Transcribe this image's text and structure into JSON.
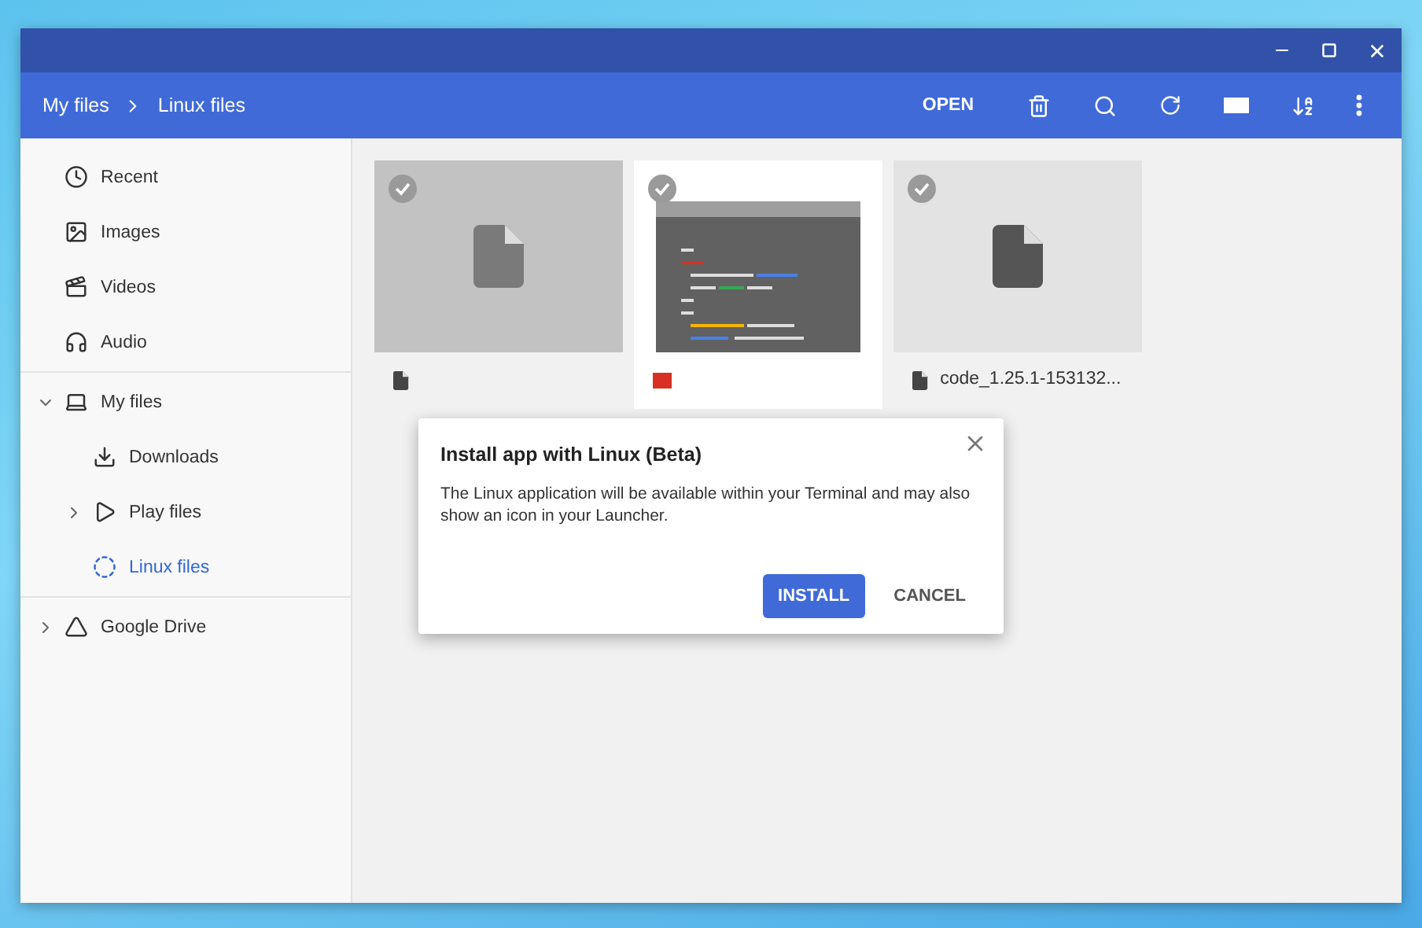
{
  "breadcrumb": [
    "My files",
    "Linux files"
  ],
  "toolbar": {
    "open_label": "OPEN"
  },
  "sidebar": {
    "items": [
      {
        "label": "Recent",
        "kind": "recent",
        "selected": false
      },
      {
        "label": "Images",
        "kind": "images",
        "selected": false
      },
      {
        "label": "Videos",
        "kind": "videos",
        "selected": false
      },
      {
        "label": "Audio",
        "kind": "audio",
        "selected": false
      },
      {
        "label": "My files",
        "kind": "computer",
        "selected": false,
        "expanded": true,
        "children": [
          {
            "label": "Downloads",
            "kind": "download",
            "selected": false
          },
          {
            "label": "Play files",
            "kind": "play",
            "selected": false,
            "expanded": false
          },
          {
            "label": "Linux files",
            "kind": "linux",
            "selected": true
          }
        ]
      },
      {
        "label": "Google Drive",
        "kind": "drive",
        "selected": false,
        "expanded": false
      }
    ]
  },
  "files": [
    {
      "kind": "generic-light",
      "hovered": false
    },
    {
      "kind": "screenshot",
      "hovered": true
    },
    {
      "kind": "generic-dark",
      "hovered": false,
      "name": "code_1.25.1-153132..."
    }
  ],
  "dialog": {
    "title": "Install app with Linux (Beta)",
    "message": "The Linux application will be available within your Terminal and may also show an icon in your Launcher.",
    "buttons": [
      {
        "label": "INSTALL",
        "kind": "primary"
      },
      {
        "label": "CANCEL",
        "kind": "text"
      }
    ]
  }
}
